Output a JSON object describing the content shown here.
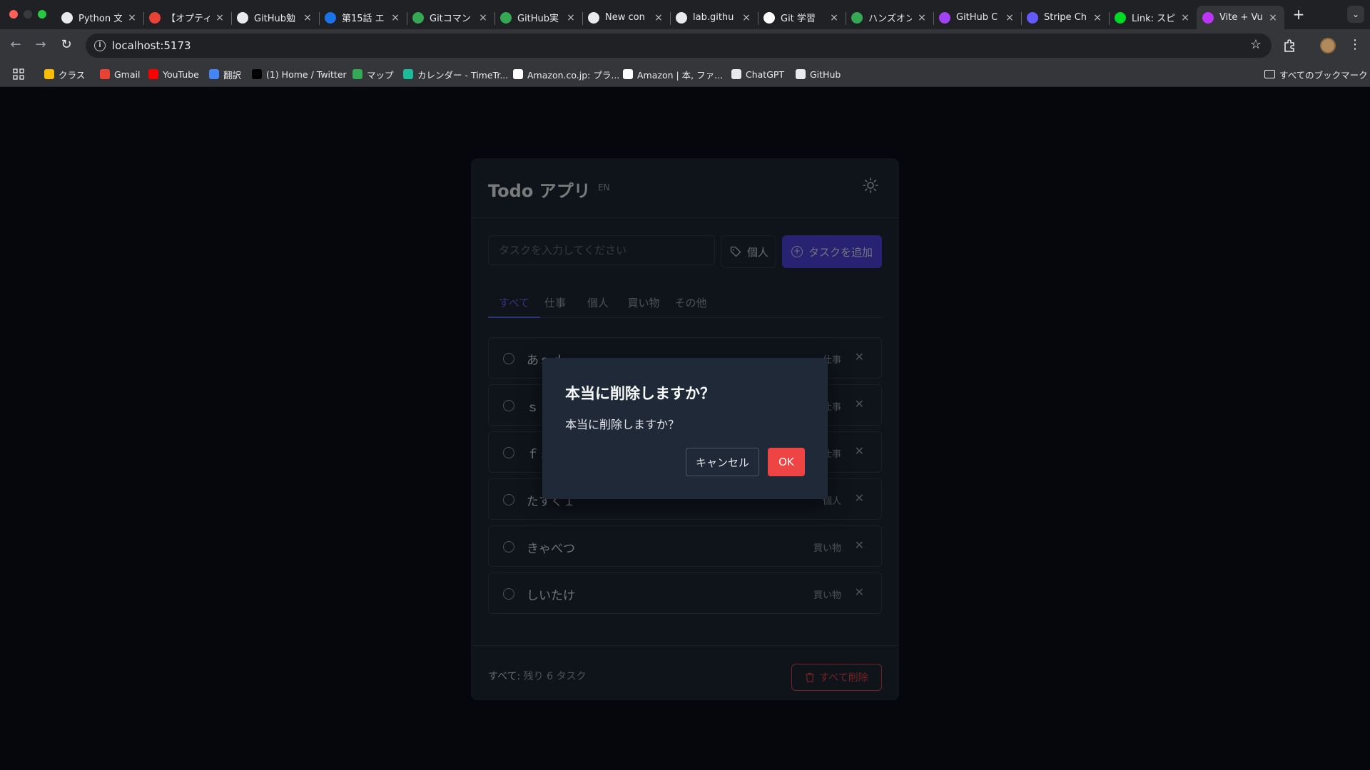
{
  "browser": {
    "tabs": [
      {
        "title": "Python 文",
        "icon": "github-icon",
        "color": "#e8eaed"
      },
      {
        "title": "【オプティ",
        "icon": "gmail-icon",
        "color": "#ea4335"
      },
      {
        "title": "GitHub勉",
        "icon": "github-icon",
        "color": "#e8eaed"
      },
      {
        "title": "第15話 エ",
        "icon": "it-icon",
        "color": "#1a73e8"
      },
      {
        "title": "Gitコマン",
        "icon": "green-icon",
        "color": "#34a853"
      },
      {
        "title": "GitHub実",
        "icon": "green-icon",
        "color": "#34a853"
      },
      {
        "title": "New con",
        "icon": "copilot-icon",
        "color": "#e8eaed"
      },
      {
        "title": "lab.githu",
        "icon": "globe-icon",
        "color": "#e8eaed"
      },
      {
        "title": "Git 学習",
        "icon": "p-icon",
        "color": "#ffffff"
      },
      {
        "title": "ハンズオン",
        "icon": "green-icon",
        "color": "#34a853"
      },
      {
        "title": "GitHub C",
        "icon": "purple-icon",
        "color": "#a142f4"
      },
      {
        "title": "Stripe Ch",
        "icon": "stripe-icon",
        "color": "#635bff"
      },
      {
        "title": "Link: スピ",
        "icon": "link-icon",
        "color": "#00d924"
      },
      {
        "title": "Vite + Vu",
        "icon": "vite-icon",
        "color": "#bd34fe",
        "active": true
      }
    ],
    "url": "localhost:5173",
    "bookmarks": [
      {
        "label": "クラス",
        "color": "#fbbc04"
      },
      {
        "label": "Gmail",
        "color": "#ea4335"
      },
      {
        "label": "YouTube",
        "color": "#ff0000"
      },
      {
        "label": "翻訳",
        "color": "#4285f4"
      },
      {
        "label": "(1) Home / Twitter",
        "color": "#000000"
      },
      {
        "label": "マップ",
        "color": "#34a853"
      },
      {
        "label": "カレンダー - TimeTr...",
        "color": "#1abc9c"
      },
      {
        "label": "Amazon.co.jp: プラ...",
        "color": "#ffffff"
      },
      {
        "label": "Amazon | 本, ファ...",
        "color": "#ffffff"
      },
      {
        "label": "ChatGPT",
        "color": "#e8eaed"
      },
      {
        "label": "GitHub",
        "color": "#e8eaed"
      }
    ],
    "all_bookmarks": "すべてのブックマーク"
  },
  "app": {
    "title": "Todo アプリ",
    "lang": "EN",
    "input_placeholder": "タスクを入力してください",
    "category": "個人",
    "add_label": "タスクを追加",
    "filters": [
      "すべて",
      "仕事",
      "個人",
      "買い物",
      "その他"
    ],
    "active_filter": 0,
    "tasks": [
      {
        "text": "あｓｄ",
        "category": "仕事"
      },
      {
        "text": "ｓｆ",
        "category": "仕事"
      },
      {
        "text": "ｆｓ",
        "category": "仕事"
      },
      {
        "text": "たすく１",
        "category": "個人"
      },
      {
        "text": "きゃべつ",
        "category": "買い物"
      },
      {
        "text": "しいたけ",
        "category": "買い物"
      }
    ],
    "summary_label": "すべて:",
    "summary_rest": "残り 6 タスク",
    "clear_all_label": "すべて削除"
  },
  "dialog": {
    "title": "本当に削除しますか？",
    "message": "本当に削除しますか？",
    "cancel_label": "キャンセル",
    "ok_label": "OK"
  },
  "colors": {
    "accent": "#6366f1",
    "danger": "#ef4444",
    "background": "#0b0f1a",
    "card": "#1f2937"
  }
}
